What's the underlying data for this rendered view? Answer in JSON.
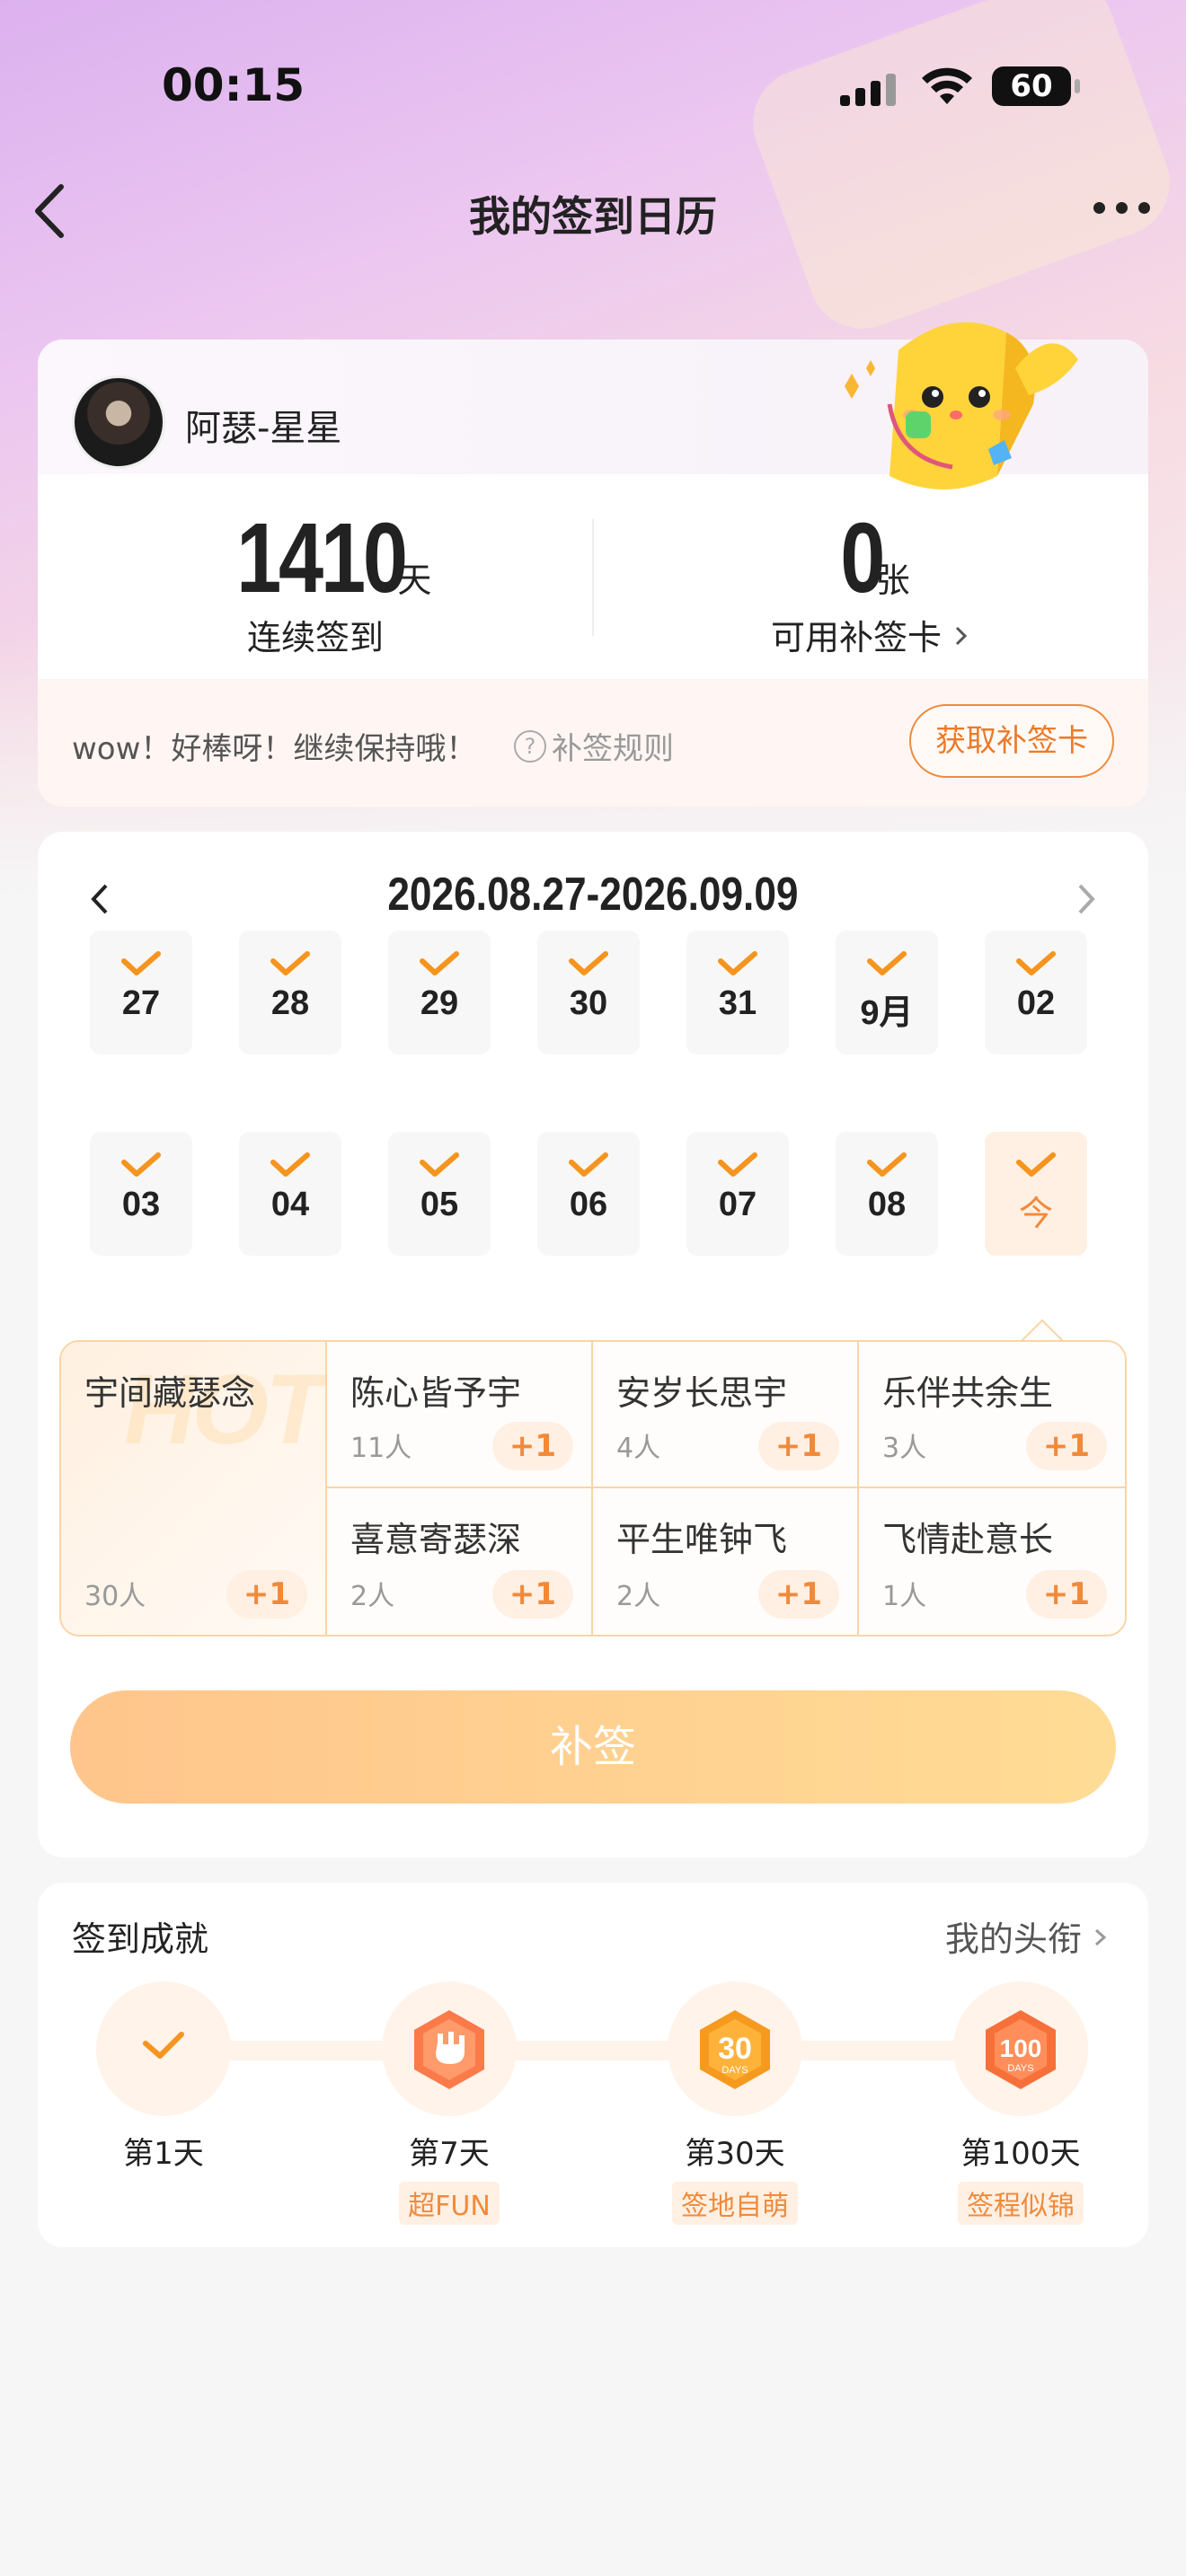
{
  "status_bar": {
    "time": "00:15",
    "battery": "60"
  },
  "nav": {
    "title": "我的签到日历"
  },
  "profile": {
    "username": "阿瑟-星星",
    "consecutive_days": "1410",
    "consecutive_unit": "天",
    "consecutive_label": "连续签到",
    "makeup_cards": "0",
    "makeup_unit": "张",
    "makeup_label": "可用补签卡",
    "encourage": "wow！好棒呀！继续保持哦！",
    "rule_label": "补签规则",
    "get_card_label": "获取补签卡"
  },
  "calendar": {
    "range": "2026.08.27-2026.09.09",
    "days": [
      {
        "label": "27",
        "checked": true
      },
      {
        "label": "28",
        "checked": true
      },
      {
        "label": "29",
        "checked": true
      },
      {
        "label": "30",
        "checked": true
      },
      {
        "label": "31",
        "checked": true
      },
      {
        "label": "9月",
        "checked": true
      },
      {
        "label": "02",
        "checked": true
      },
      {
        "label": "03",
        "checked": true
      },
      {
        "label": "04",
        "checked": true
      },
      {
        "label": "05",
        "checked": true
      },
      {
        "label": "06",
        "checked": true
      },
      {
        "label": "07",
        "checked": true
      },
      {
        "label": "08",
        "checked": true
      },
      {
        "label": "今",
        "checked": true,
        "today": true
      }
    ],
    "tags": [
      {
        "name": "宇间藏瑟念",
        "count": "30人",
        "plus": "+1"
      },
      {
        "name": "陈心皆予宇",
        "count": "11人",
        "plus": "+1"
      },
      {
        "name": "安岁长思宇",
        "count": "4人",
        "plus": "+1"
      },
      {
        "name": "乐伴共余生",
        "count": "3人",
        "plus": "+1"
      },
      {
        "name": "喜意寄瑟深",
        "count": "2人",
        "plus": "+1"
      },
      {
        "name": "平生唯钟飞",
        "count": "2人",
        "plus": "+1"
      },
      {
        "name": "飞情赴意长",
        "count": "1人",
        "plus": "+1"
      }
    ],
    "makeup_button": "补签"
  },
  "achievements": {
    "title": "签到成就",
    "link": "我的头衔",
    "items": [
      {
        "day": "第1天",
        "tag": ""
      },
      {
        "day": "第7天",
        "tag": "超FUN"
      },
      {
        "day": "第30天",
        "tag": "签地自萌"
      },
      {
        "day": "第100天",
        "tag": "签程似锦"
      }
    ]
  },
  "colors": {
    "accent": "#f08a3b",
    "accent_light": "#fff0e3",
    "button_start": "#ffc58c",
    "button_end": "#ffdc95"
  }
}
